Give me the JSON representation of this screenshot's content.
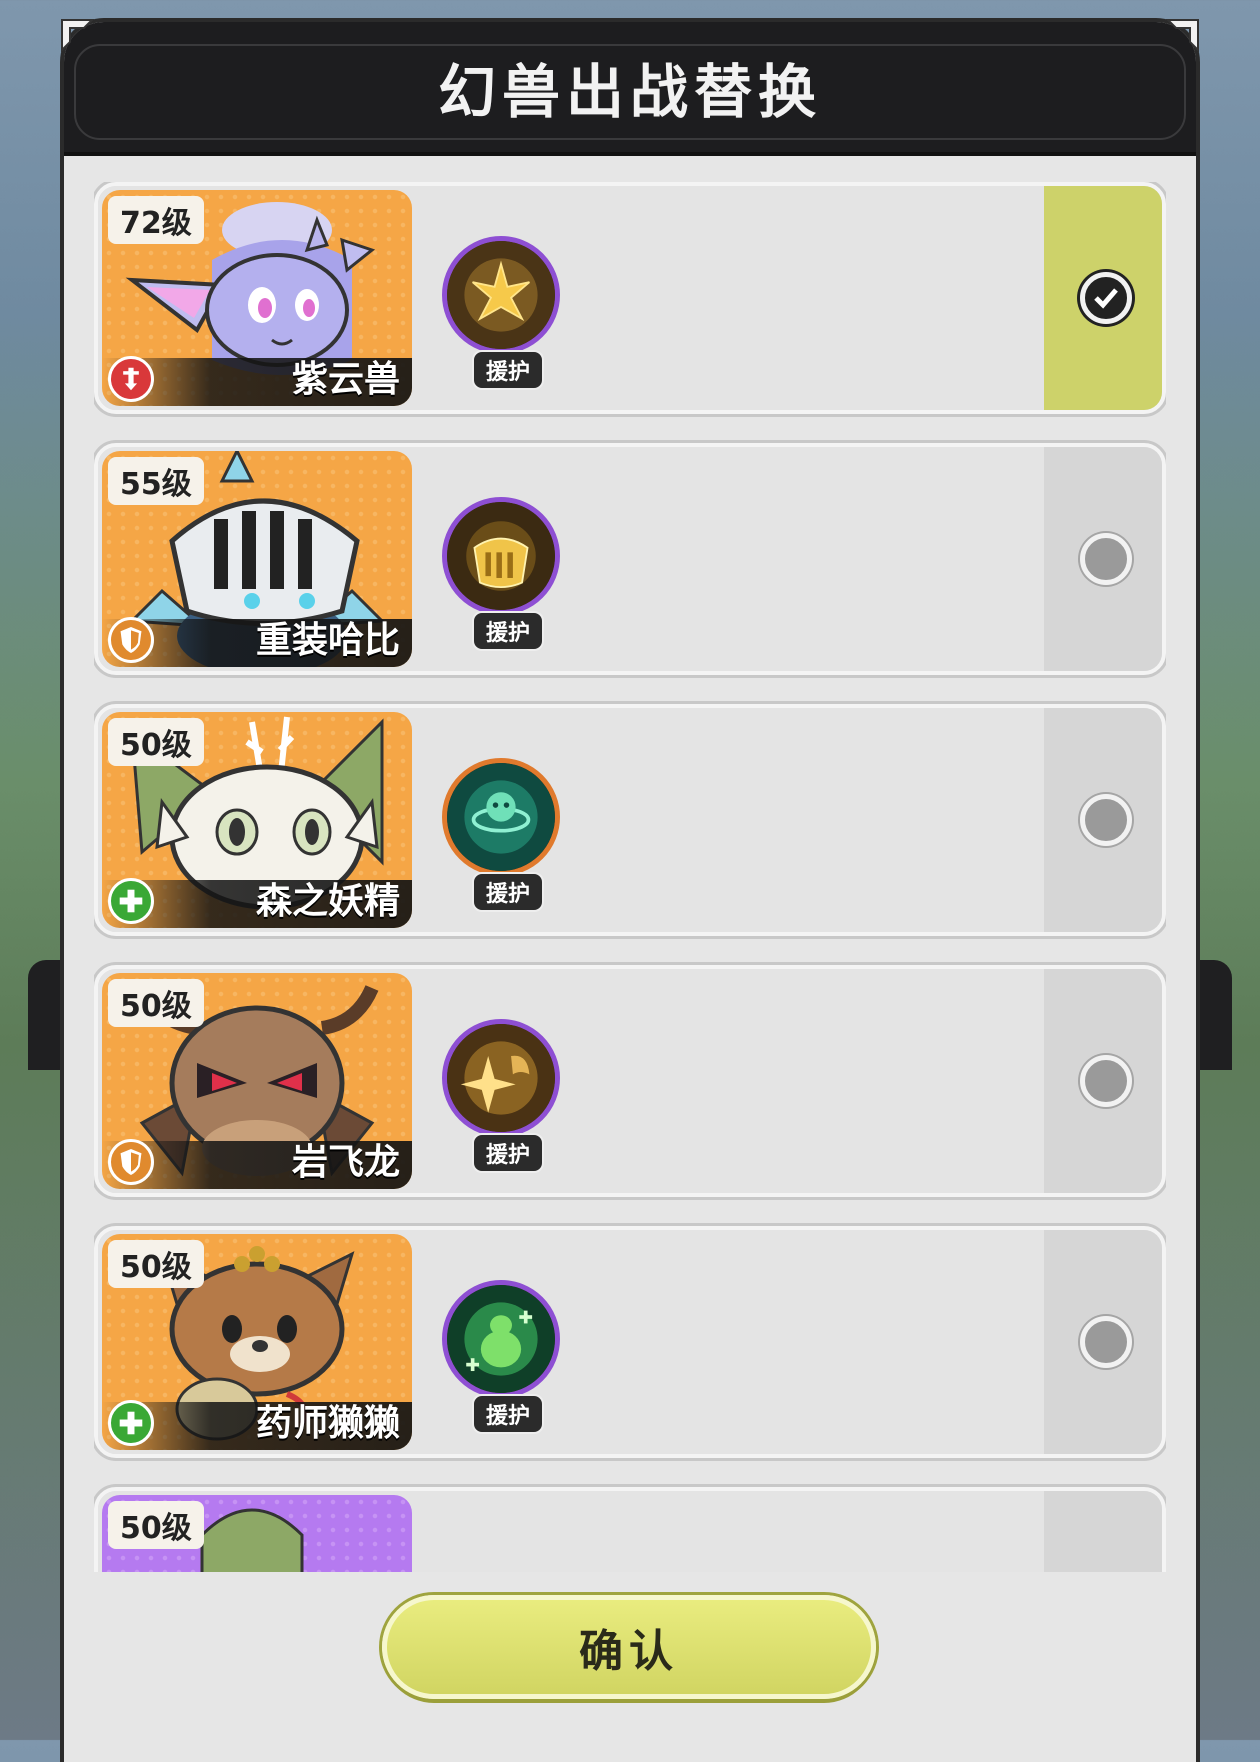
{
  "dialog": {
    "title": "幻兽出战替换",
    "confirm_label": "确认"
  },
  "beasts": [
    {
      "name": "紫云兽",
      "level": "72级",
      "role": "attack",
      "skill_tag": "援护",
      "skill_icon": "golden-lotus-icon",
      "selected": true
    },
    {
      "name": "重装哈比",
      "level": "55级",
      "role": "defense",
      "skill_tag": "援护",
      "skill_icon": "golden-helmet-icon",
      "selected": false
    },
    {
      "name": "森之妖精",
      "level": "50级",
      "role": "heal",
      "skill_tag": "援护",
      "skill_icon": "green-spirit-icon",
      "selected": false
    },
    {
      "name": "岩飞龙",
      "level": "50级",
      "role": "defense",
      "skill_tag": "援护",
      "skill_icon": "golden-star-dragon-icon",
      "selected": false
    },
    {
      "name": "药师獭獭",
      "level": "50级",
      "role": "heal",
      "skill_tag": "援护",
      "skill_icon": "green-gourd-icon",
      "selected": false
    },
    {
      "name": "",
      "level": "50级",
      "role": "",
      "skill_tag": "",
      "skill_icon": "",
      "selected": false
    }
  ],
  "colors": {
    "selected_strip": "#cdd26a",
    "portrait_orange": "#f5a646",
    "portrait_purple": "#b57af0",
    "attack_badge": "#d9383a",
    "defense_badge": "#e08a2e",
    "heal_badge": "#3aa835"
  }
}
